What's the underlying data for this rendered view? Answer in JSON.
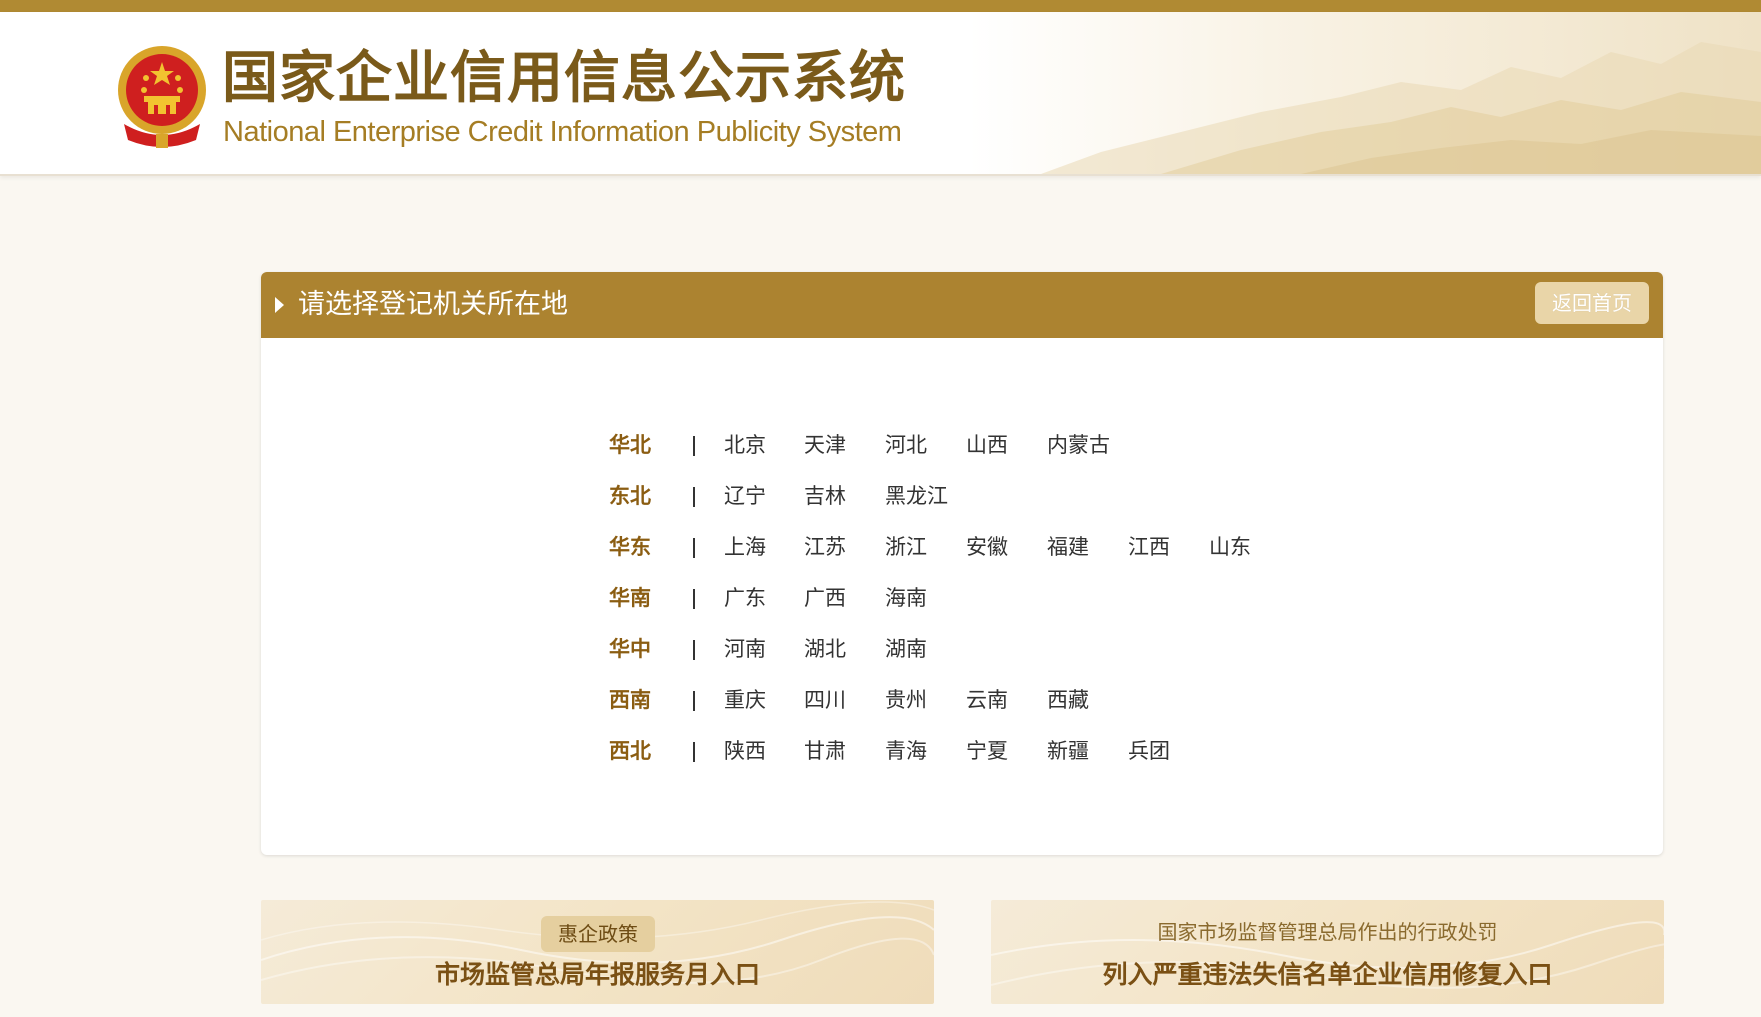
{
  "header": {
    "title_cn": "国家企业信用信息公示系统",
    "title_en": "National Enterprise Credit Information Publicity System"
  },
  "panel": {
    "title": "请选择登记机关所在地",
    "home_button": "返回首页"
  },
  "regions": [
    {
      "name": "华北",
      "provinces": [
        "北京",
        "天津",
        "河北",
        "山西",
        "内蒙古"
      ]
    },
    {
      "name": "东北",
      "provinces": [
        "辽宁",
        "吉林",
        "黑龙江"
      ]
    },
    {
      "name": "华东",
      "provinces": [
        "上海",
        "江苏",
        "浙江",
        "安徽",
        "福建",
        "江西",
        "山东"
      ]
    },
    {
      "name": "华南",
      "provinces": [
        "广东",
        "广西",
        "海南"
      ]
    },
    {
      "name": "华中",
      "provinces": [
        "河南",
        "湖北",
        "湖南"
      ]
    },
    {
      "name": "西南",
      "provinces": [
        "重庆",
        "四川",
        "贵州",
        "云南",
        "西藏"
      ]
    },
    {
      "name": "西北",
      "provinces": [
        "陕西",
        "甘肃",
        "青海",
        "宁夏",
        "新疆",
        "兵团"
      ]
    }
  ],
  "entries": {
    "left": {
      "tag": "惠企政策",
      "label": "市场监管总局年报服务月入口"
    },
    "right": {
      "subtitle": "国家市场监督管理总局作出的行政处罚",
      "label": "列入严重违法失信名单企业信用修复入口"
    }
  },
  "colors": {
    "brand_gold": "#ac8330",
    "top_bar": "#b08a33",
    "region_name": "#8b5d12",
    "title_brown": "#7a5a1a"
  }
}
